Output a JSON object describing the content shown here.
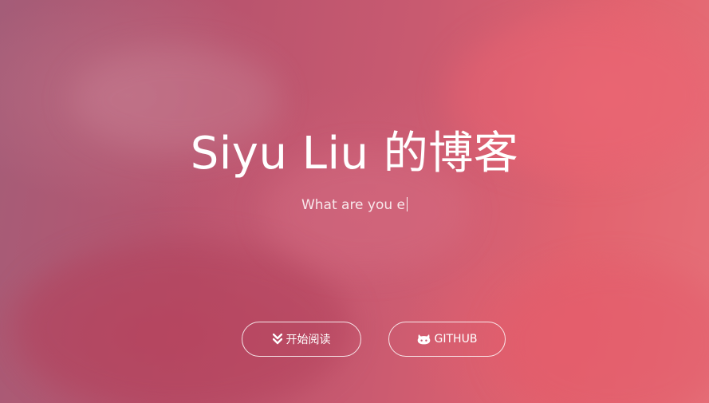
{
  "hero": {
    "title": "Siyu Liu 的博客",
    "subtitle": "What are you e"
  },
  "buttons": {
    "read_label": "开始阅读",
    "read_icon": "double-chevron-down-icon",
    "github_label": "GITHUB",
    "github_icon": "github-icon"
  },
  "colors": {
    "background_left": "#a45d78",
    "background_right": "#e66f78",
    "text": "#ffffff"
  }
}
